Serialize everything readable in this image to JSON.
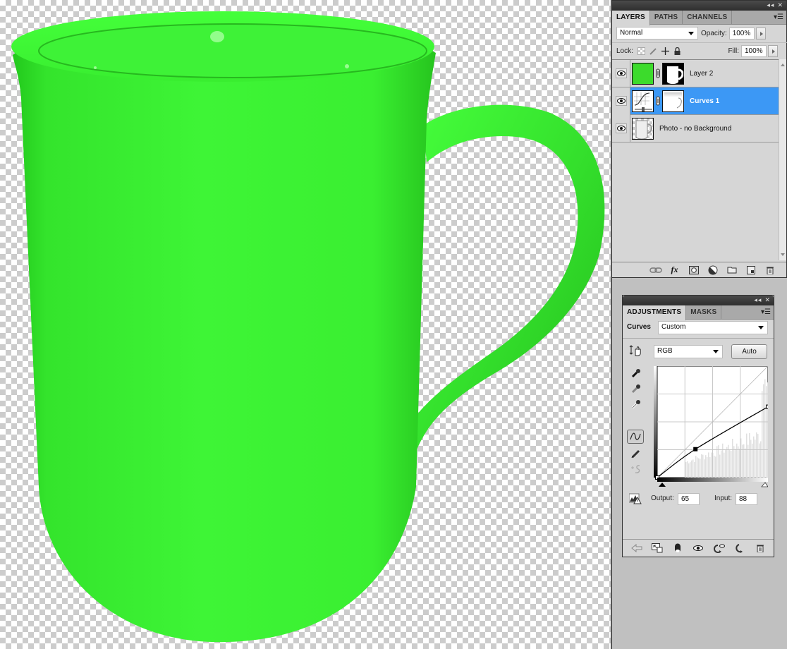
{
  "canvas": {
    "subject": "green mug on transparent background",
    "mug_color": "#3cf432",
    "transparency_pattern": [
      "#ffffff",
      "#cccccc"
    ]
  },
  "layers_panel": {
    "tabs": [
      {
        "label": "LAYERS",
        "active": true
      },
      {
        "label": "PATHS",
        "active": false
      },
      {
        "label": "CHANNELS",
        "active": false
      }
    ],
    "blend_mode": "Normal",
    "opacity_label": "Opacity:",
    "opacity_value": "100%",
    "lock_label": "Lock:",
    "fill_label": "Fill:",
    "fill_value": "100%",
    "layers": [
      {
        "name": "Layer 2",
        "visible": true,
        "selected": false,
        "thumb": "green-fill",
        "has_mask": true
      },
      {
        "name": "Curves 1",
        "visible": true,
        "selected": true,
        "thumb": "curves-adjustment",
        "has_mask": true
      },
      {
        "name": "Photo -  no Background",
        "visible": true,
        "selected": false,
        "thumb": "mug-photo",
        "has_mask": false
      }
    ],
    "footer_icons": [
      "link-layers-icon",
      "fx-icon",
      "add-mask-icon",
      "adjustment-layer-icon",
      "new-group-icon",
      "new-layer-icon",
      "trash-icon"
    ],
    "selection_color": "#3c98f5"
  },
  "adjustments_panel": {
    "tabs": [
      {
        "label": "ADJUSTMENTS",
        "active": true
      },
      {
        "label": "MASKS",
        "active": false
      }
    ],
    "adjustment_title": "Curves",
    "preset": "Custom",
    "channel": "RGB",
    "auto_label": "Auto",
    "output_label": "Output:",
    "output_value": "65",
    "input_label": "Input:",
    "input_value": "88",
    "curve_points": [
      {
        "input": 0,
        "output": 0
      },
      {
        "input": 88,
        "output": 65
      },
      {
        "input": 255,
        "output": 162
      }
    ],
    "selected_point_index": 1,
    "footer_icons": [
      "back-icon",
      "clip-to-layer-icon",
      "mask-icon",
      "visibility-icon",
      "view-previous-icon",
      "reset-icon",
      "trash-icon"
    ]
  }
}
